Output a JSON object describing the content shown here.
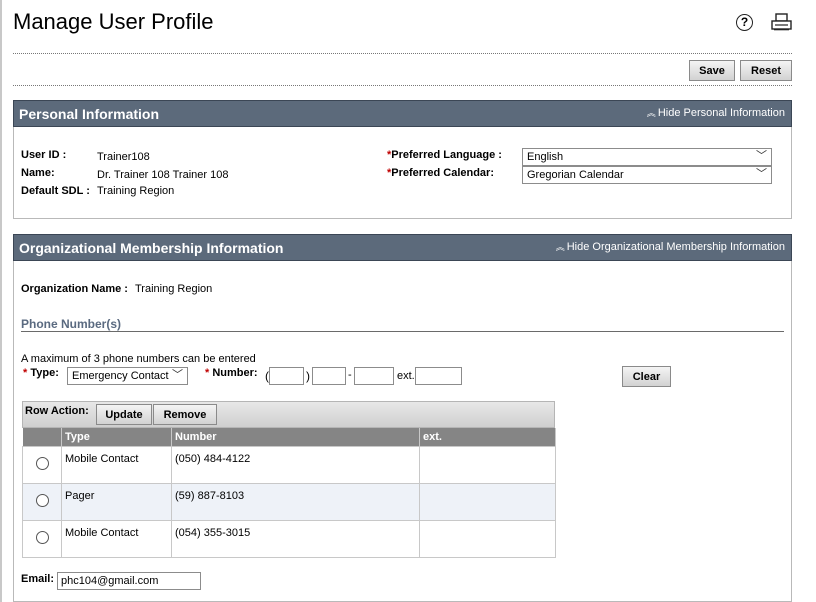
{
  "page": {
    "title": "Manage User Profile"
  },
  "toolbar": {
    "save_label": "Save",
    "reset_label": "Reset"
  },
  "icons": {
    "help": "help-icon",
    "print": "print-icon"
  },
  "personal": {
    "section_title": "Personal Information",
    "toggle_label": "Hide Personal Information",
    "user_id_label": "User ID :",
    "user_id": "Trainer108",
    "name_label": "Name:",
    "name": "Dr. Trainer 108 Trainer 108",
    "sdl_label": "Default SDL :",
    "sdl": "Training Region",
    "language_label": "Preferred Language :",
    "language_value": "English",
    "calendar_label": "Preferred Calendar:",
    "calendar_value": "Gregorian Calendar"
  },
  "org": {
    "section_title": "Organizational Membership Information",
    "toggle_label": "Hide Organizational Membership Information",
    "org_name_label": "Organization Name :",
    "org_name": "Training Region"
  },
  "phone": {
    "heading": "Phone Number(s)",
    "note": "A maximum of 3 phone numbers can be entered",
    "type_label": "Type:",
    "type_value": "Emergency Contact",
    "number_label": "Number:",
    "open_paren": "(",
    "close_paren": ")",
    "dash": "-",
    "ext_label": "ext.",
    "clear_label": "Clear",
    "row_action_label": "Row Action:",
    "update_label": "Update",
    "remove_label": "Remove",
    "columns": [
      "Type",
      "Number",
      "ext."
    ],
    "rows": [
      {
        "type": "Mobile Contact",
        "number": "(050) 484-4122",
        "ext": ""
      },
      {
        "type": "Pager",
        "number": "(59) 887-8103",
        "ext": ""
      },
      {
        "type": "Mobile Contact",
        "number": "(054) 355-3015",
        "ext": ""
      }
    ]
  },
  "email": {
    "label": "Email:",
    "value": "phc104@gmail.com"
  },
  "colors": {
    "section_header": "#5c6a7b",
    "required": "#c00000",
    "table_header": "#858585"
  }
}
